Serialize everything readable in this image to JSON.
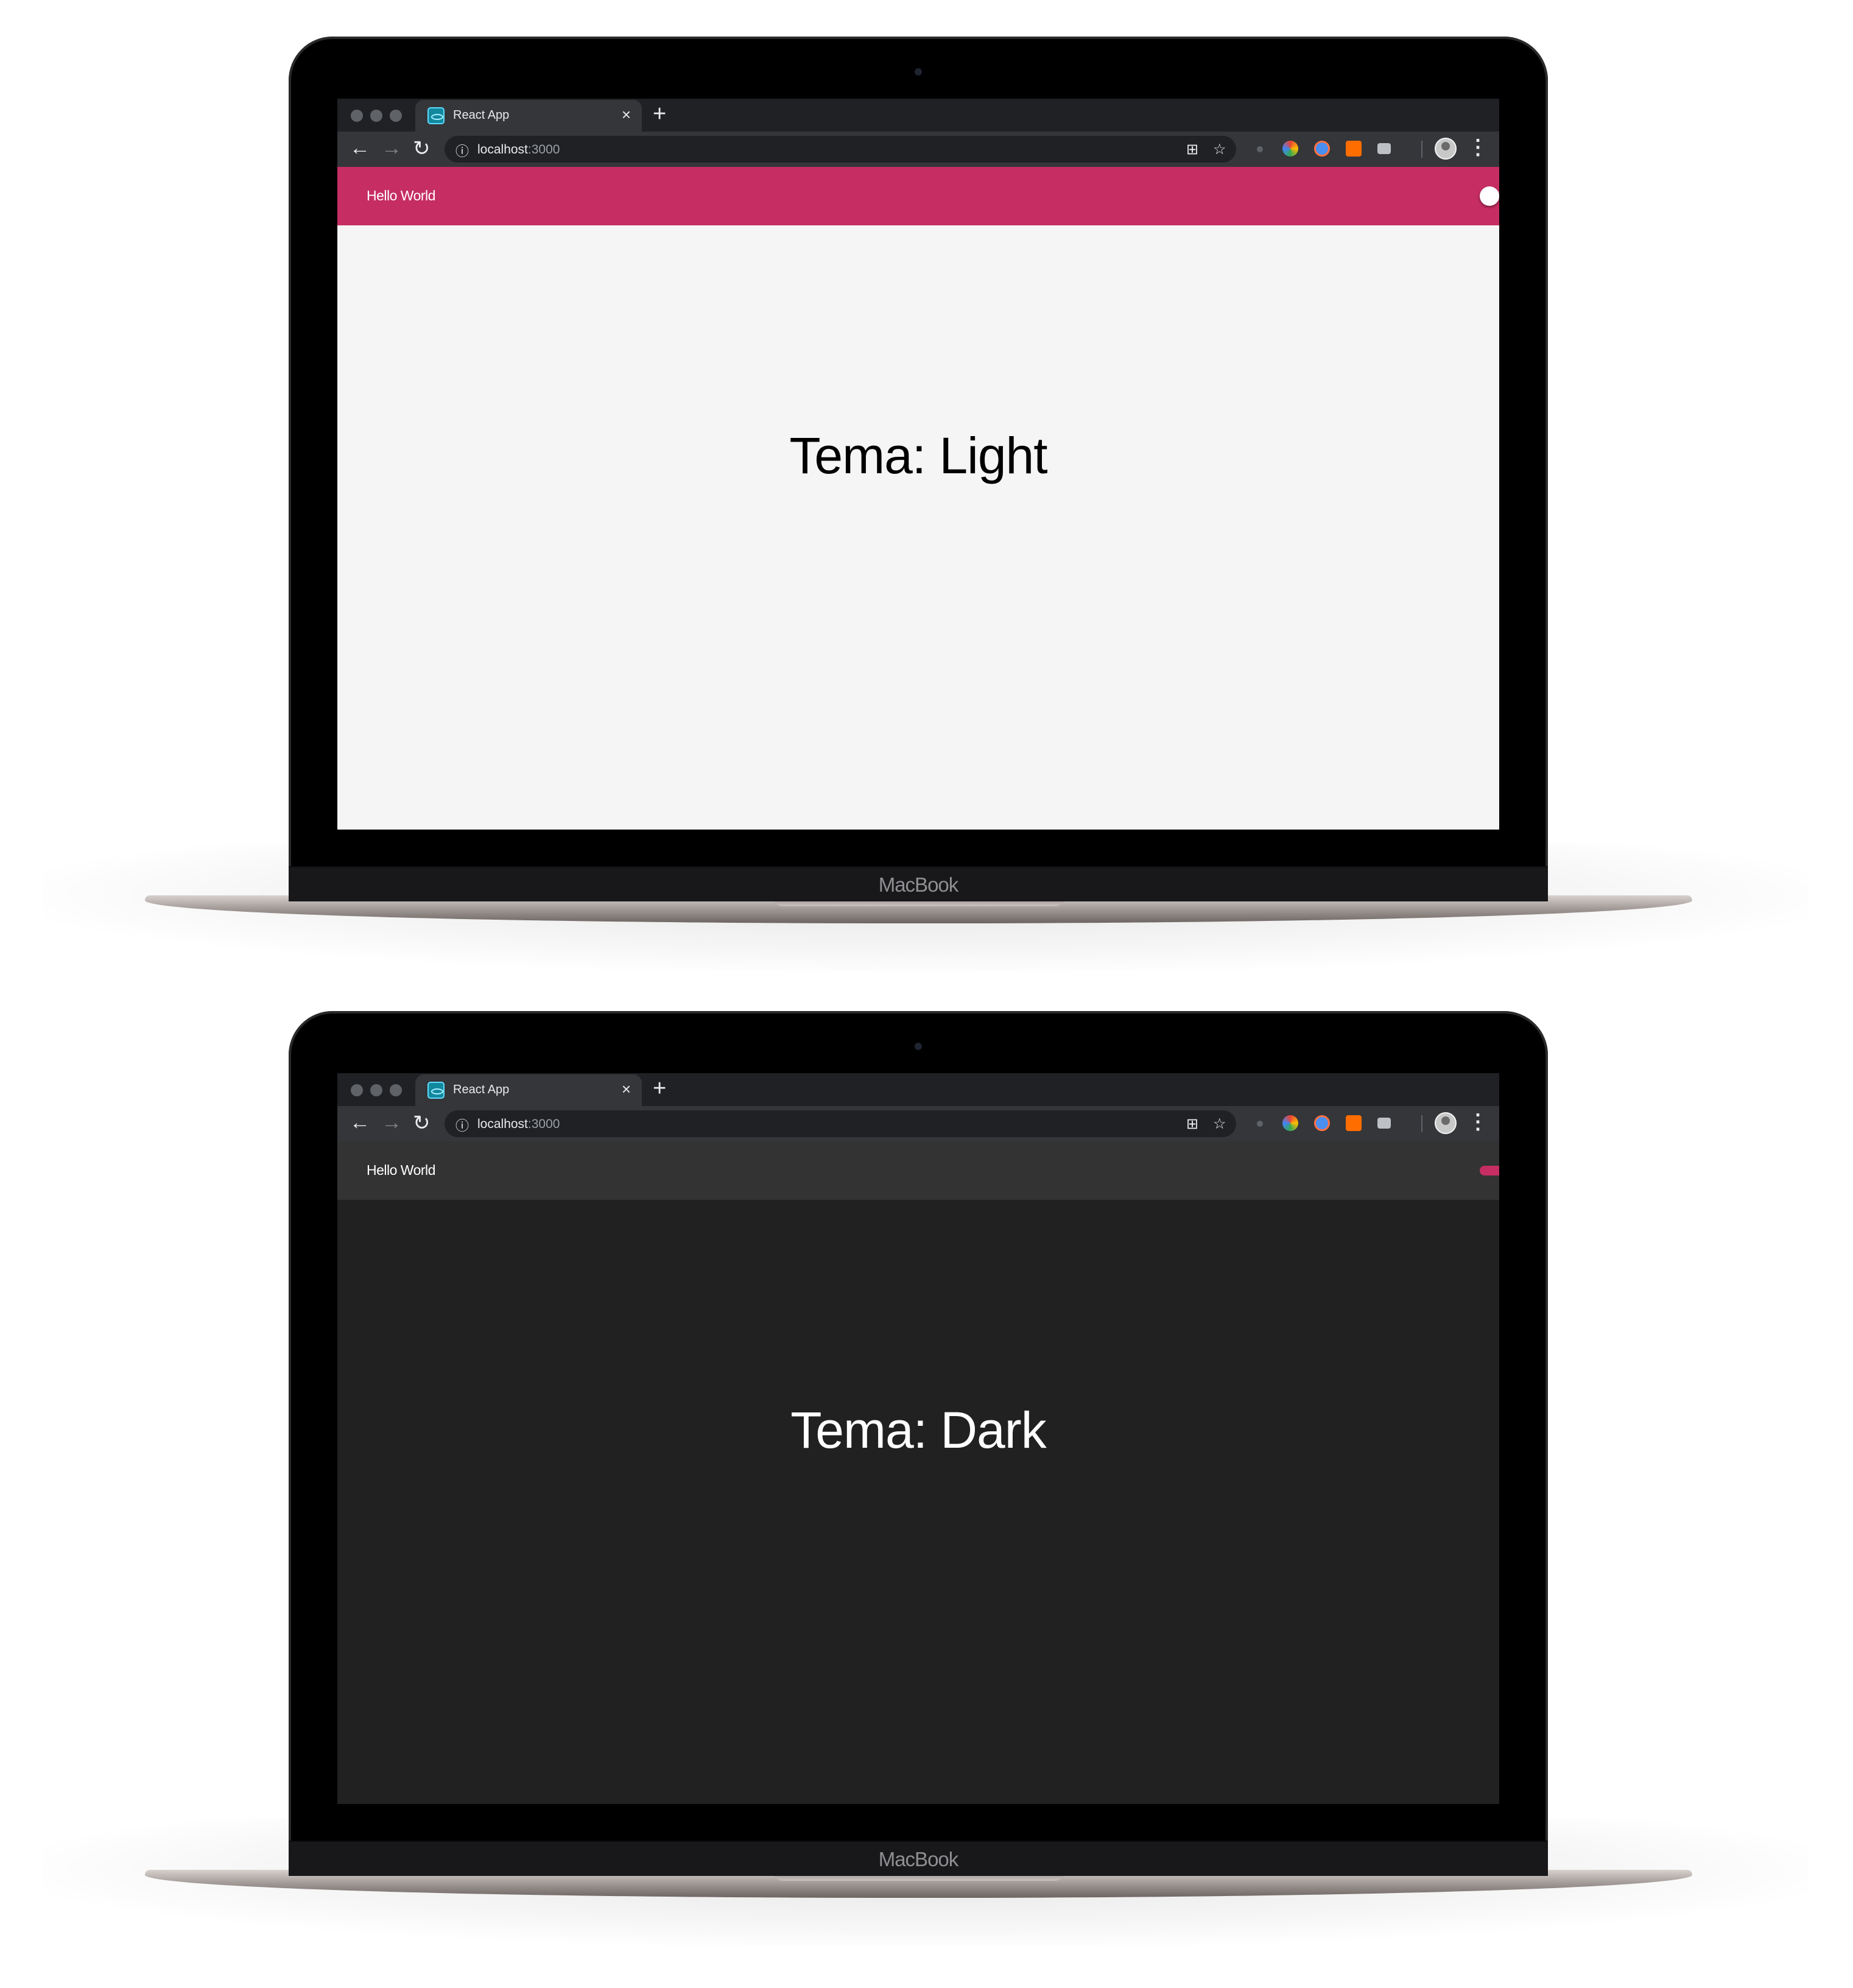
{
  "laptops": [
    {
      "theme": "light",
      "browser": {
        "tab_title": "React App",
        "url_host": "localhost",
        "url_port": ":3000",
        "tab_close": "×",
        "new_tab": "+"
      },
      "app": {
        "appbar_title": "Hello World",
        "theme_label": "Tema: Light",
        "appbar_color": "#c62d63",
        "content_bg": "#f5f5f5",
        "switch_checked": false
      },
      "device_brand": "MacBook"
    },
    {
      "theme": "dark",
      "browser": {
        "tab_title": "React App",
        "url_host": "localhost",
        "url_port": ":3000",
        "tab_close": "×",
        "new_tab": "+"
      },
      "app": {
        "appbar_title": "Hello World",
        "theme_label": "Tema: Dark",
        "appbar_color": "#333333",
        "content_bg": "#212121",
        "switch_checked": true
      },
      "device_brand": "MacBook"
    }
  ],
  "icons": {
    "back": "back-arrow-icon",
    "forward": "forward-arrow-icon",
    "reload": "reload-icon",
    "info": "site-info-icon",
    "translate": "translate-icon",
    "bookmark": "star-icon",
    "menu": "kebab-menu-icon"
  }
}
